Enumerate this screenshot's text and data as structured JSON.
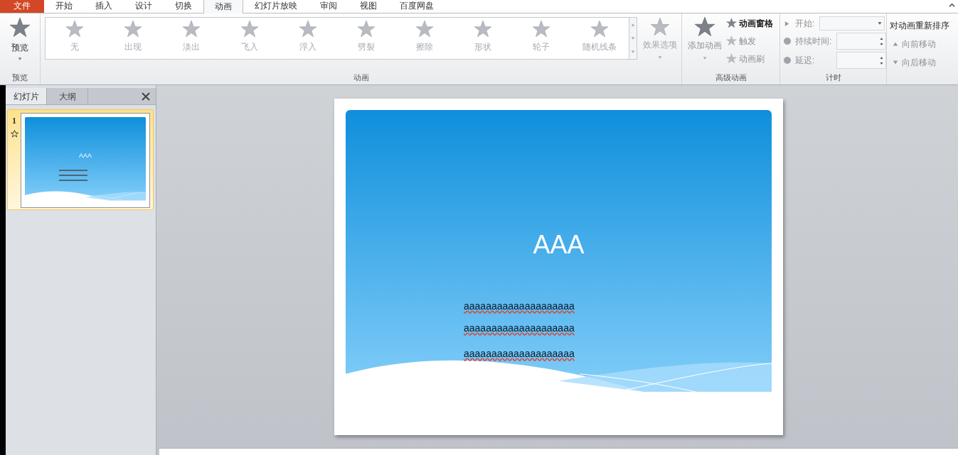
{
  "tabs": [
    {
      "label": "文件",
      "kind": "file",
      "selected": false
    },
    {
      "label": "开始",
      "kind": "tab",
      "selected": false
    },
    {
      "label": "插入",
      "kind": "tab",
      "selected": false
    },
    {
      "label": "设计",
      "kind": "tab",
      "selected": false
    },
    {
      "label": "切换",
      "kind": "tab",
      "selected": false
    },
    {
      "label": "动画",
      "kind": "tab",
      "selected": true
    },
    {
      "label": "幻灯片放映",
      "kind": "tab",
      "selected": false
    },
    {
      "label": "审阅",
      "kind": "tab",
      "selected": false
    },
    {
      "label": "视图",
      "kind": "tab",
      "selected": false
    },
    {
      "label": "百度网盘",
      "kind": "tab",
      "selected": false
    }
  ],
  "ribbon": {
    "preview": {
      "button": "预览",
      "group_label": "预览"
    },
    "animation": {
      "group_label": "动画",
      "effect_options": "效果选项",
      "gallery": [
        {
          "label": "无",
          "disabled": true
        },
        {
          "label": "出现",
          "disabled": true
        },
        {
          "label": "淡出",
          "disabled": true
        },
        {
          "label": "飞入",
          "disabled": true
        },
        {
          "label": "浮入",
          "disabled": true
        },
        {
          "label": "劈裂",
          "disabled": true
        },
        {
          "label": "擦除",
          "disabled": true
        },
        {
          "label": "形状",
          "disabled": true
        },
        {
          "label": "轮子",
          "disabled": true
        },
        {
          "label": "随机线条",
          "disabled": true
        }
      ]
    },
    "advanced": {
      "group_label": "高级动画",
      "add_animation": "添加动画",
      "items": [
        {
          "label": "动画窗格",
          "disabled": false
        },
        {
          "label": "触发",
          "disabled": true
        },
        {
          "label": "动画刷",
          "disabled": true
        }
      ]
    },
    "timing": {
      "group_label": "计时",
      "start": "开始:",
      "duration": "持续时间:",
      "delay": "延迟:",
      "reorder_title": "对动画重新排序",
      "move_earlier": "向前移动",
      "move_later": "向后移动"
    }
  },
  "slides_panel": {
    "tabs": [
      {
        "label": "幻灯片",
        "selected": true
      },
      {
        "label": "大纲",
        "selected": false
      }
    ],
    "thumbnails": [
      {
        "number": "1",
        "title": "AAA",
        "selected": true
      }
    ]
  },
  "slide": {
    "title": "AAA",
    "lines": [
      "aaaaaaaaaaaaaaaaaaaa",
      "aaaaaaaaaaaaaaaaaaaa",
      "aaaaaaaaaaaaaaaaaaaa"
    ]
  }
}
